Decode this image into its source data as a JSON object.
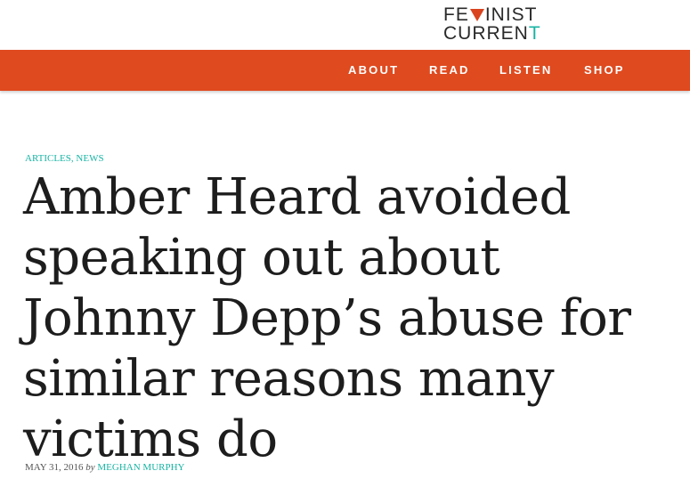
{
  "logo": {
    "line1_prefix": "FE",
    "line1_suffix": "INIST",
    "line2_prefix": "CURREN",
    "line2_accent": "T",
    "accent_color": "#18b4a4",
    "brand_color": "#df4a1f"
  },
  "nav": {
    "about": "ABOUT",
    "read": "READ",
    "listen": "LISTEN",
    "shop": "SHOP"
  },
  "article": {
    "categories": [
      "ARTICLES",
      "NEWS"
    ],
    "category_separator": ", ",
    "title_lines": [
      "Amber Heard avoided",
      "speaking out about",
      "Johnny Depp’s abuse for",
      "similar reasons many",
      "victims do"
    ],
    "date": "MAY 31, 2016",
    "by": "by",
    "author": "MEGHAN MURPHY"
  }
}
